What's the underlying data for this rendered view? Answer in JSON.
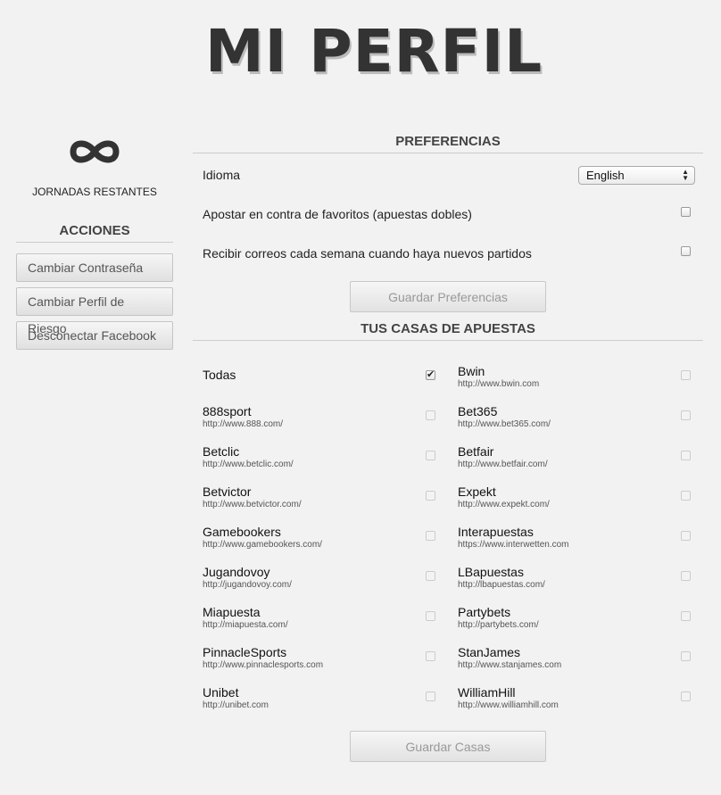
{
  "page_title": "MI PERFIL",
  "sidebar": {
    "jornadas_label": "JORNADAS RESTANTES",
    "acciones_title": "ACCIONES",
    "buttons": [
      {
        "label": "Cambiar Contraseña"
      },
      {
        "label": "Cambiar Perfil de Riesgo"
      },
      {
        "label": "Desconectar Facebook"
      }
    ]
  },
  "preferences": {
    "title": "PREFERENCIAS",
    "language_label": "Idioma",
    "language_value": "English",
    "bet_against_label": "Apostar en contra de favoritos (apuestas dobles)",
    "bet_against_checked": false,
    "weekly_email_label": "Recibir correos cada semana cuando haya nuevos partidos",
    "weekly_email_checked": false,
    "save_label": "Guardar Preferencias"
  },
  "casas": {
    "title": "TUS CASAS DE APUESTAS",
    "items": [
      {
        "name": "Todas",
        "url": "",
        "checked": true
      },
      {
        "name": "Bwin",
        "url": "http://www.bwin.com",
        "checked": false
      },
      {
        "name": "888sport",
        "url": "http://www.888.com/",
        "checked": false
      },
      {
        "name": "Bet365",
        "url": "http://www.bet365.com/",
        "checked": false
      },
      {
        "name": "Betclic",
        "url": "http://www.betclic.com/",
        "checked": false
      },
      {
        "name": "Betfair",
        "url": "http://www.betfair.com/",
        "checked": false
      },
      {
        "name": "Betvictor",
        "url": "http://www.betvictor.com/",
        "checked": false
      },
      {
        "name": "Expekt",
        "url": "http://www.expekt.com/",
        "checked": false
      },
      {
        "name": "Gamebookers",
        "url": "http://www.gamebookers.com/",
        "checked": false
      },
      {
        "name": "Interapuestas",
        "url": "https://www.interwetten.com",
        "checked": false
      },
      {
        "name": "Jugandovoy",
        "url": "http://jugandovoy.com/",
        "checked": false
      },
      {
        "name": "LBapuestas",
        "url": "http://lbapuestas.com/",
        "checked": false
      },
      {
        "name": "Miapuesta",
        "url": "http://miapuesta.com/",
        "checked": false
      },
      {
        "name": "Partybets",
        "url": "http://partybets.com/",
        "checked": false
      },
      {
        "name": "PinnacleSports",
        "url": "http://www.pinnaclesports.com",
        "checked": false
      },
      {
        "name": "StanJames",
        "url": "http://www.stanjames.com",
        "checked": false
      },
      {
        "name": "Unibet",
        "url": "http://unibet.com",
        "checked": false
      },
      {
        "name": "WilliamHill",
        "url": "http://www.williamhill.com",
        "checked": false
      }
    ],
    "save_label": "Guardar Casas"
  },
  "icons": {
    "infinity": "infinity-icon",
    "select_arrows": "select-arrows-icon",
    "checkbox": "checkbox-icon"
  }
}
